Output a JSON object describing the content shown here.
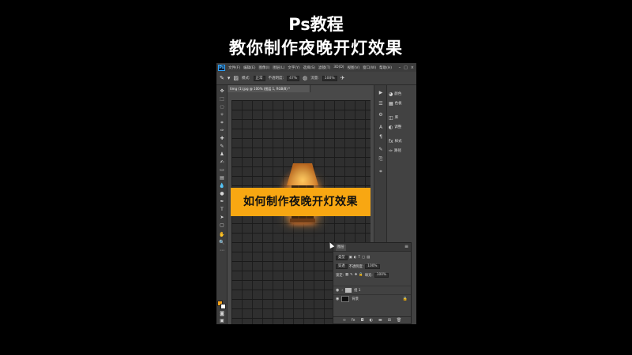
{
  "video": {
    "title_line1": "Ps教程",
    "title_line2": "教你制作夜晚开灯效果"
  },
  "menubar": {
    "logo": "Ps",
    "items": [
      "文件(F)",
      "编辑(E)",
      "图像(I)",
      "图层(L)",
      "文字(Y)",
      "选择(S)",
      "滤镜(T)",
      "3D(D)",
      "视图(V)",
      "窗口(W)",
      "帮助(H)"
    ],
    "window_controls": [
      "–",
      "□",
      "×"
    ]
  },
  "options_bar": {
    "mode_label": "模式:",
    "mode_value": "正常",
    "opacity_label": "不透明度:",
    "opacity_value": "47%",
    "flow_label": "流量:",
    "flow_value": "100%"
  },
  "document": {
    "tab_label": "timg (1).jpg @ 100% (图层 1, RGB/8) *"
  },
  "banner": {
    "text": "如何制作夜晚开灯效果"
  },
  "panels": {
    "items": [
      {
        "icon": "palette-icon",
        "label": "颜色"
      },
      {
        "icon": "swatches-icon",
        "label": "色板"
      },
      {
        "icon": "library-icon",
        "label": "库"
      },
      {
        "icon": "adjustments-icon",
        "label": "调整"
      },
      {
        "icon": "styles-icon",
        "label": "样式"
      },
      {
        "icon": "paths-icon",
        "label": "路径"
      }
    ]
  },
  "layers_panel": {
    "tab": "图层",
    "filter_label": "类型",
    "blend_mode": "穿透",
    "opacity_label": "不透明度:",
    "opacity_value": "100%",
    "lock_label": "锁定:",
    "fill_label": "填充:",
    "fill_value": "100%",
    "layers": [
      {
        "name": "组 1",
        "kind": "group"
      },
      {
        "name": "背景",
        "kind": "background"
      }
    ],
    "footer_icons": [
      "link-icon",
      "fx-icon",
      "mask-icon",
      "adjustment-layer-icon",
      "folder-icon",
      "new-layer-icon",
      "trash-icon"
    ]
  },
  "colors": {
    "foreground": "#f5a11a",
    "background": "#ffffff",
    "banner": "#f8a712"
  }
}
